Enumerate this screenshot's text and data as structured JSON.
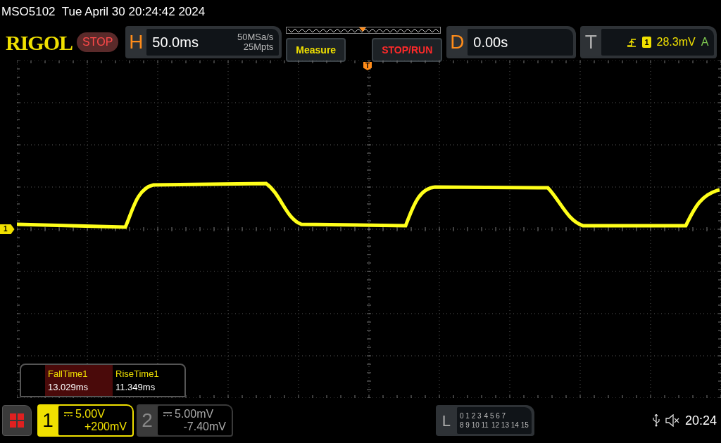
{
  "status_line": "MSO5102  Tue April 30 20:24:42 2024",
  "logo": "RIGOL",
  "run_state": "STOP",
  "horizontal": {
    "letter": "H",
    "timebase": "50.0ms",
    "sample_rate": "50MSa/s",
    "memory_depth": "25Mpts"
  },
  "buttons": [
    {
      "label": "Measure",
      "kind": "measure"
    },
    {
      "label": "STOP/RUN",
      "kind": "run"
    }
  ],
  "delay": {
    "letter": "D",
    "value": "0.00s"
  },
  "trigger": {
    "letter": "T",
    "source": "1",
    "level": "28.3mV",
    "mode": "A"
  },
  "trigger_marker": "T",
  "ground_marker": "1",
  "measurements": [
    {
      "label": "FallTime1",
      "value": "13.029ms",
      "highlighted": true
    },
    {
      "label": "RiseTime1",
      "value": "11.349ms",
      "highlighted": false
    }
  ],
  "channels": [
    {
      "number": "1",
      "scale": "5.00V",
      "offset": "+200mV",
      "active": true
    },
    {
      "number": "2",
      "scale": "5.00mV",
      "offset": "-7.40mV",
      "active": false
    }
  ],
  "logic": {
    "letter": "L",
    "rows": [
      [
        "0 1 2 3",
        "4 5 6 7"
      ],
      [
        "8 9 10 11",
        "12 13 14 15"
      ]
    ]
  },
  "clock": "20:24"
}
